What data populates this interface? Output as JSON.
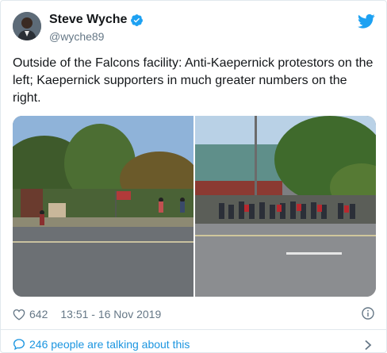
{
  "author": {
    "name": "Steve Wyche",
    "handle": "@wyche89"
  },
  "tweet": {
    "text": "Outside of the Falcons facility: Anti-Kaepernick protestors on the left; Kaepernick supporters in much greater numbers on the right."
  },
  "stats": {
    "likes": "642",
    "timestamp": "13:51 - 16 Nov 2019"
  },
  "footer": {
    "talking": "246 people are talking about this"
  },
  "colors": {
    "brand_blue": "#1da1f2",
    "link_blue": "#1b95e0",
    "muted": "#657786"
  },
  "icons": [
    "verified-badge-icon",
    "twitter-bird-icon",
    "heart-icon",
    "info-icon",
    "comment-bubble-icon",
    "chevron-right-icon"
  ]
}
